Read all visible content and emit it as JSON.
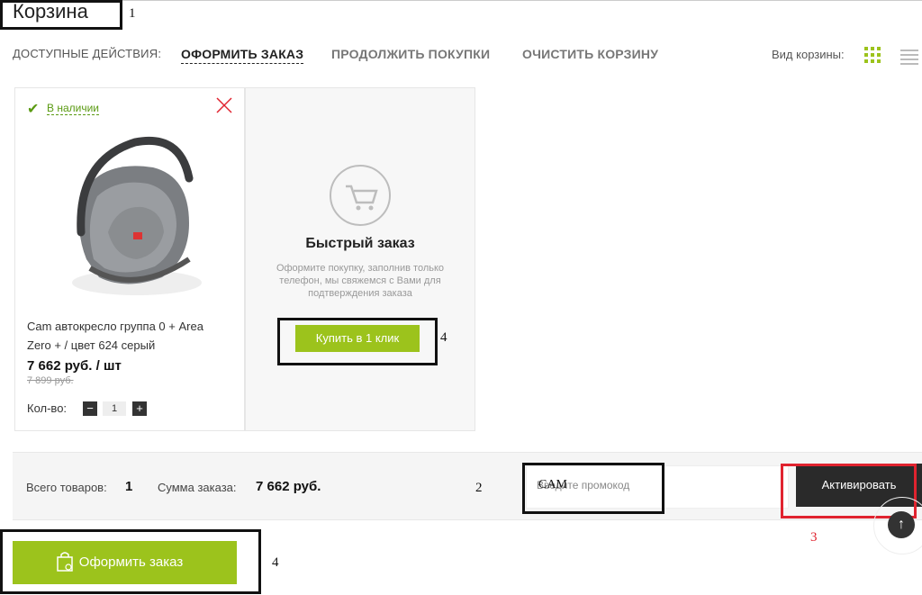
{
  "page": {
    "title": "Корзина"
  },
  "actions": {
    "label": "ДОСТУПНЫЕ ДЕЙСТВИЯ:",
    "checkout": "ОФОРМИТЬ ЗАКАЗ",
    "continue": "ПРОДОЛЖИТЬ ПОКУПКИ",
    "clear": "ОЧИСТИТЬ КОРЗИНУ"
  },
  "view": {
    "label": "Вид корзины:",
    "options": [
      "grid-icon",
      "list-icon"
    ],
    "active": "grid"
  },
  "product": {
    "availability": "В наличии",
    "name": "Cam автокресло группа 0 + Area Zero + / цвет 624 серый",
    "price": "7 662 руб. / шт",
    "old_price": "7 899 руб.",
    "qty_label": "Кол-во:",
    "qty": "1",
    "minus": "−",
    "plus": "+"
  },
  "quick_order": {
    "title": "Быстрый заказ",
    "description": "Оформите покупку, заполнив только телефон, мы свяжемся с Вами для подтверждения заказа",
    "button": "Купить в 1 клик"
  },
  "summary": {
    "items_label": "Всего товаров:",
    "items_count": "1",
    "sum_label": "Сумма заказа:",
    "sum_value": "7 662 руб."
  },
  "promo": {
    "placeholder": "Введите промокод",
    "value": "CAM",
    "button": "Активировать"
  },
  "checkout_button": "Оформить заказ",
  "annotations": {
    "a1": "1",
    "a2": "2",
    "a3": "3",
    "a4": "4",
    "a4b": "4"
  },
  "colors": {
    "accent": "#9cc31c",
    "instock": "#5a9a12",
    "annotation_red": "#e0232f",
    "dark_button": "#2a2a2a"
  }
}
